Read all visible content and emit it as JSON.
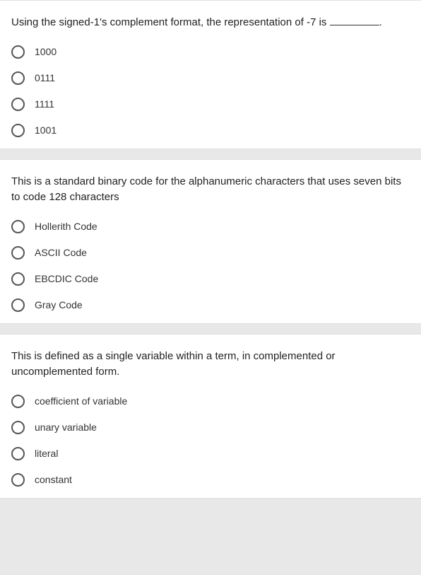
{
  "questions": [
    {
      "text_pre": "Using the signed-1's complement format, the representation of -7 is ",
      "text_post": ".",
      "has_blank": true,
      "options": [
        "1000",
        "0111",
        "1111",
        "1001"
      ]
    },
    {
      "text_pre": "This is a standard binary code for the alphanumeric characters that uses seven bits to code 128 characters",
      "text_post": "",
      "has_blank": false,
      "options": [
        "Hollerith Code",
        "ASCII Code",
        "EBCDIC Code",
        "Gray Code"
      ]
    },
    {
      "text_pre": "This is defined as a single variable within a term, in complemented or uncomplemented form.",
      "text_post": "",
      "has_blank": false,
      "options": [
        "coefficient of variable",
        "unary variable",
        "literal",
        "constant"
      ]
    }
  ]
}
